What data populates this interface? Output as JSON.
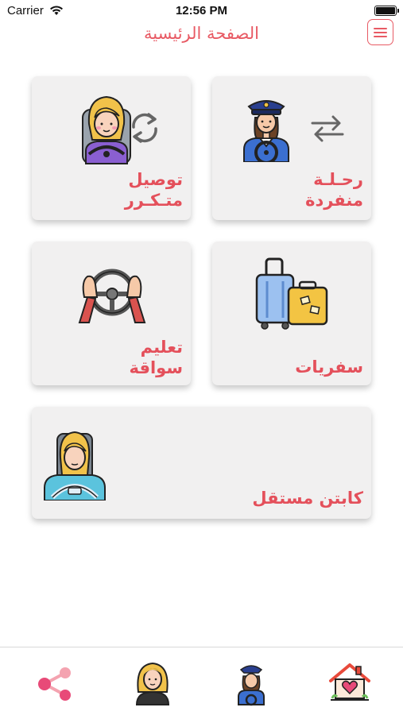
{
  "status_bar": {
    "carrier": "Carrier",
    "time": "12:56 PM"
  },
  "header": {
    "title": "الصفحة الرئيسية",
    "menu_icon": "hamburger-menu-icon"
  },
  "cards": [
    {
      "id": "single-trip",
      "label_line1": "رحـلـة",
      "label_line2": "منفردة",
      "icon": "driver-captain-exchange-icon"
    },
    {
      "id": "recurring-ride",
      "label_line1": "توصيل",
      "label_line2": "متـكـرر",
      "icon": "woman-driver-sync-icon"
    },
    {
      "id": "travel",
      "label_line1": "سفريات",
      "icon": "luggage-icon"
    },
    {
      "id": "driving-lessons",
      "label_line1": "تعليم",
      "label_line2": "سواقة",
      "icon": "steering-wheel-hands-icon"
    },
    {
      "id": "independent-captain",
      "label_line1": "كابتن مستقل",
      "icon": "woman-driver-icon"
    }
  ],
  "bottom_nav": [
    {
      "id": "share",
      "icon": "share-icon"
    },
    {
      "id": "driver-woman",
      "icon": "woman-avatar-icon"
    },
    {
      "id": "captain",
      "icon": "captain-avatar-icon"
    },
    {
      "id": "home",
      "icon": "home-heart-icon"
    }
  ],
  "colors": {
    "accent": "#e85a64",
    "card_bg": "#f1f0f0",
    "text_dark": "#111111"
  }
}
